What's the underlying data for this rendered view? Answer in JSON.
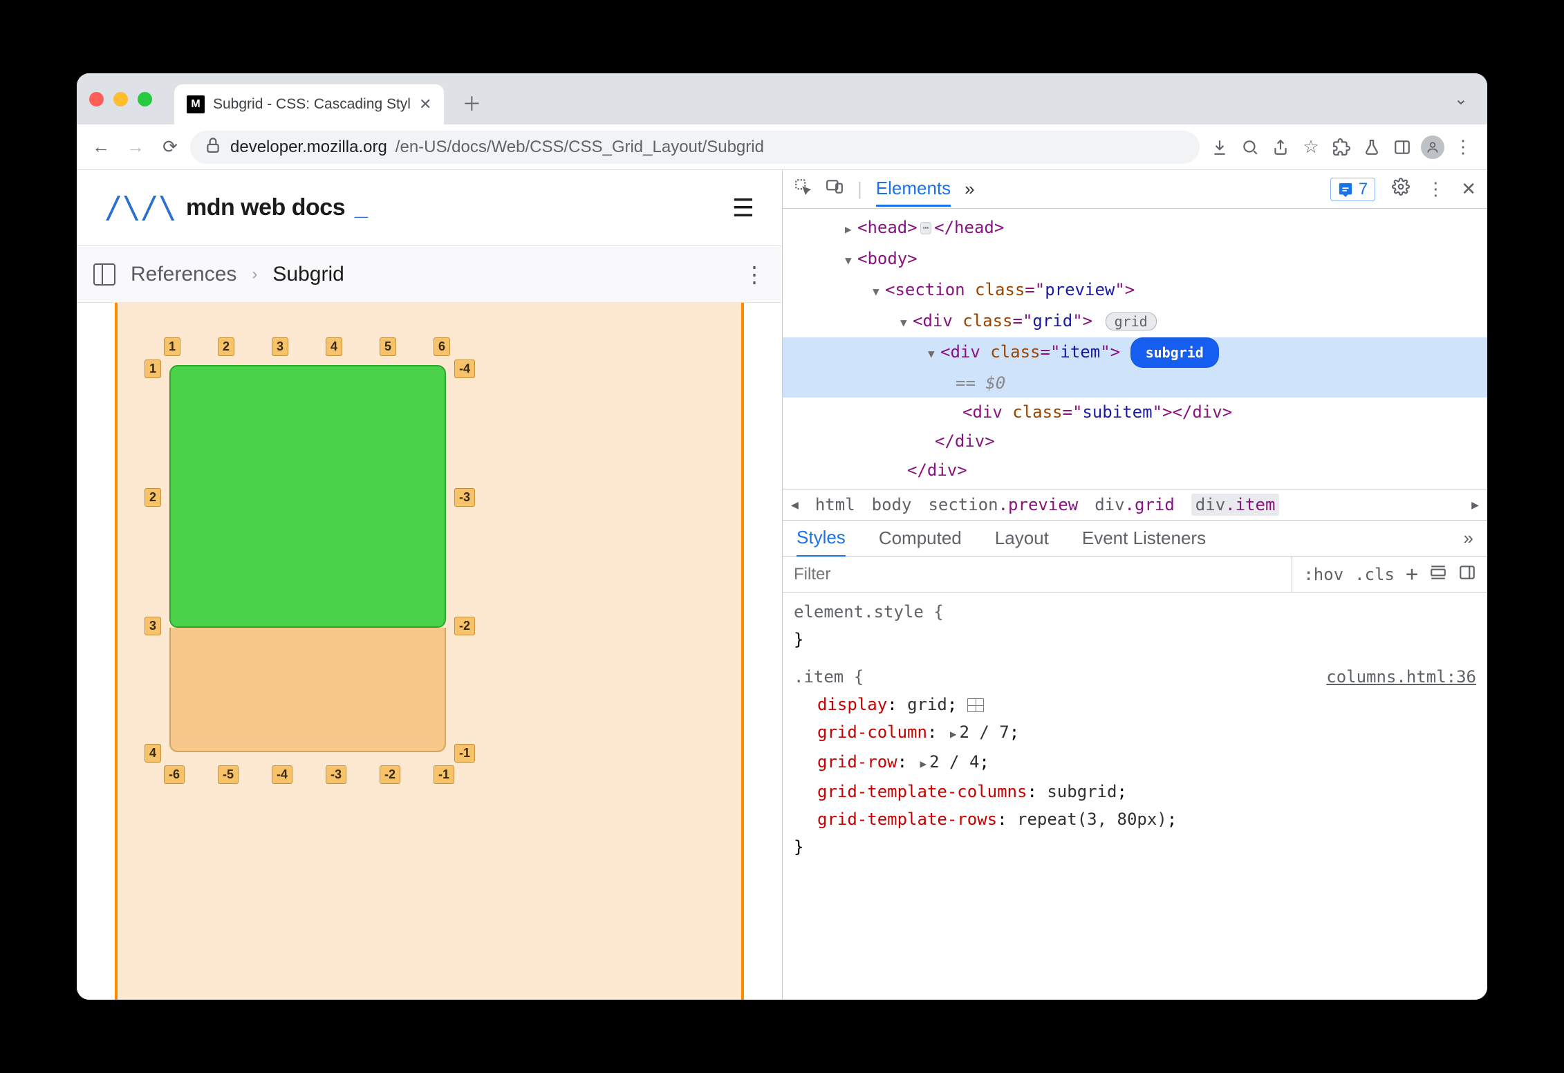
{
  "tab": {
    "title": "Subgrid - CSS: Cascading Styl"
  },
  "url": {
    "host": "developer.mozilla.org",
    "path": "/en-US/docs/Web/CSS/CSS_Grid_Layout/Subgrid"
  },
  "mdn": {
    "brand": "mdn web docs",
    "blink": "_"
  },
  "breadcrumb": {
    "ref": "References",
    "cur": "Subgrid"
  },
  "devtools": {
    "tabs": {
      "elements": "Elements",
      "more": "»",
      "issues_count": "7"
    },
    "dom": {
      "head_open": "<head>",
      "head_close": "</head>",
      "body": "<body>",
      "section": "<section",
      "section_cls": "preview",
      "div_grid": "<div",
      "div_grid_cls": "grid",
      "grid_badge": "grid",
      "div_item": "<div",
      "div_item_cls": "item",
      "item_badge": "subgrid",
      "eq": "== $0",
      "subitem": "<div class=\"subitem\"></div>",
      "close_div": "</div>"
    },
    "bc": {
      "html": "html",
      "body": "body",
      "section": "section",
      "section_cls": ".preview",
      "div1": "div",
      "div1_cls": ".grid",
      "div2": "div",
      "div2_cls": ".item"
    },
    "styles_tabs": {
      "styles": "Styles",
      "computed": "Computed",
      "layout": "Layout",
      "events": "Event Listeners",
      "more": "»"
    },
    "filter": {
      "placeholder": "Filter",
      "hov": ":hov",
      "cls": ".cls"
    },
    "rules": {
      "el_style": "element.style {",
      "sel_item": ".item {",
      "src": "columns.html:36",
      "p1n": "display",
      "p1v": "grid",
      "p2n": "grid-column",
      "p2v": "2 / 7",
      "p3n": "grid-row",
      "p3v": "2 / 4",
      "p4n": "grid-template-columns",
      "p4v": "subgrid",
      "p5n": "grid-template-rows",
      "p5v": "repeat(3, 80px)"
    }
  },
  "grid_labels": {
    "top": [
      "1",
      "2",
      "3",
      "4",
      "5",
      "6"
    ],
    "left": [
      "1",
      "2",
      "3",
      "4"
    ],
    "right": [
      "-4",
      "-3",
      "-2",
      "-1"
    ],
    "bottom": [
      "-6",
      "-5",
      "-4",
      "-3",
      "-2",
      "-1"
    ]
  }
}
